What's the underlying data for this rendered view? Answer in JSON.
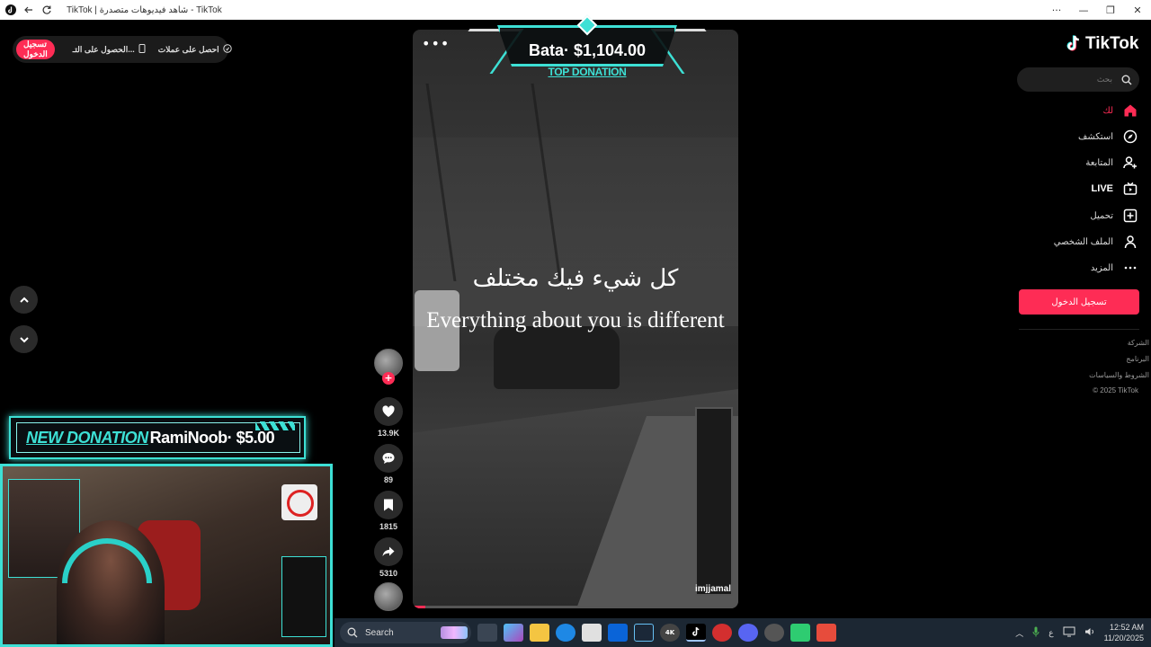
{
  "window": {
    "title": "TikTok | شاهد فيديوهات متصدرة - TikTok"
  },
  "topbar": {
    "login_label": "تسجيل الدخول",
    "get_app_label": "الحصول على التـ...",
    "get_coins_label": "احصل على عملات"
  },
  "donation": {
    "label": "NEW DONATION",
    "message": "RamiNoob· $5.00"
  },
  "top_donation": {
    "amount": "Bata· $1,104.00",
    "label": "TOP DONATION"
  },
  "video": {
    "caption_arabic": "كل شيء فيك مختلف",
    "caption_english": "Everything about you is different",
    "author": "imjjamal",
    "menu_icon": "more-dots-icon",
    "progress": 0.04
  },
  "actions": {
    "likes": "13.9K",
    "comments": "89",
    "saves": "1815",
    "shares": "5310"
  },
  "sidebar": {
    "logo": "TikTok",
    "search_placeholder": "بحث",
    "items": [
      {
        "label": "لك",
        "icon": "home-icon"
      },
      {
        "label": "استكشف",
        "icon": "compass-icon"
      },
      {
        "label": "المتابعة",
        "icon": "follow-user-icon"
      },
      {
        "label": "LIVE",
        "icon": "live-tv-icon"
      },
      {
        "label": "تحميل",
        "icon": "upload-plus-icon"
      },
      {
        "label": "الملف الشخصي",
        "icon": "profile-icon"
      },
      {
        "label": "المزيد",
        "icon": "more-dots-icon"
      }
    ],
    "login_button": "تسجيل الدخول",
    "footer": [
      "الشركة",
      "البرنامج",
      "الشروط والسياسات",
      "© 2025 TikTok"
    ]
  },
  "taskbar": {
    "search_label": "Search",
    "time": "12:52 AM",
    "date": "11/20/2025",
    "lang": "ع"
  },
  "colors": {
    "accent": "#fe2c55",
    "overlay_cyan": "#3de0d5"
  }
}
